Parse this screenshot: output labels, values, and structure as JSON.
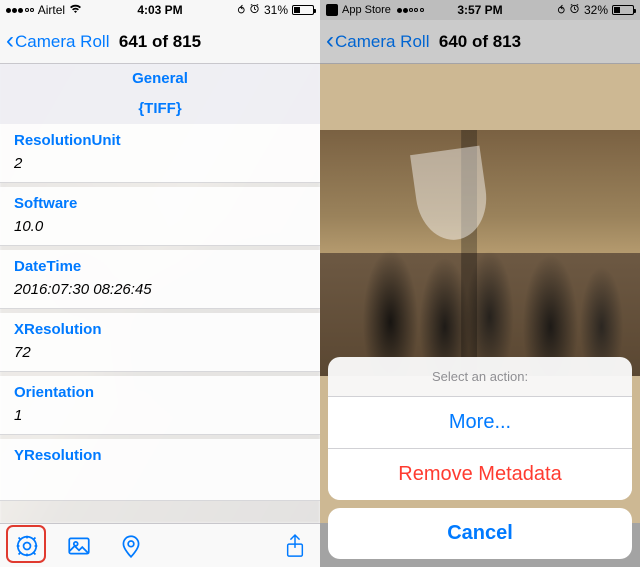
{
  "left": {
    "status": {
      "carrier": "Airtel",
      "signal_filled": 3,
      "wifi_icon": "wifi",
      "time": "4:03 PM",
      "lock": "⇪",
      "alarm": "⏰",
      "battery_pct": "31%"
    },
    "nav": {
      "back_label": "Camera Roll",
      "title": "641 of 815"
    },
    "sections": [
      {
        "header": "General"
      },
      {
        "header": "{TIFF}"
      }
    ],
    "rows": [
      {
        "key": "ResolutionUnit",
        "value": "2"
      },
      {
        "key": "Software",
        "value": "10.0"
      },
      {
        "key": "DateTime",
        "value": "2016:07:30 08:26:45"
      },
      {
        "key": "XResolution",
        "value": "72"
      },
      {
        "key": "Orientation",
        "value": "1"
      },
      {
        "key": "YResolution",
        "value": ""
      }
    ],
    "toolbar": {
      "settings_icon": "gear-icon",
      "image_icon": "photo-icon",
      "location_icon": "pin-icon",
      "share_icon": "share-icon"
    }
  },
  "right": {
    "status": {
      "back_app": "App Store",
      "signal_filled": 2,
      "time": "3:57 PM",
      "alarm": "⏰",
      "battery_pct": "32%"
    },
    "nav": {
      "back_label": "Camera Roll",
      "title": "640 of 813"
    },
    "sheet": {
      "title": "Select an action:",
      "more": "More...",
      "remove": "Remove Metadata",
      "cancel": "Cancel"
    }
  }
}
